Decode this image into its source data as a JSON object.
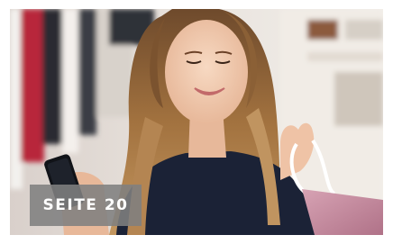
{
  "badge": {
    "label": "SEITE 20"
  },
  "colors": {
    "badge_bg": "#808080",
    "badge_text": "#ffffff",
    "bag": "#c58a9e",
    "top": "#1b2236",
    "hair": "#9a6a3e",
    "skin": "#f0c9ae",
    "background": "#e9e4df"
  }
}
